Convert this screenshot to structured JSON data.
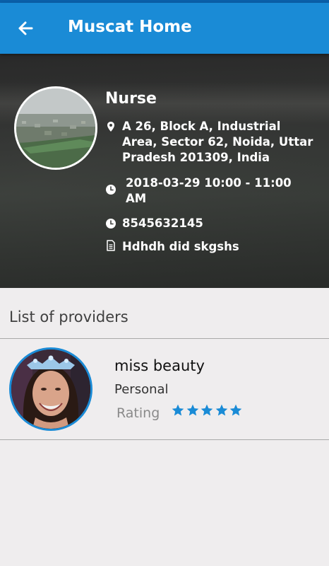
{
  "app_bar": {
    "title": "Muscat Home"
  },
  "booking": {
    "service": "Nurse",
    "address": "A 26, Block A, Industrial Area, Sector 62, Noida, Uttar Pradesh 201309, India",
    "datetime": "2018-03-29 10:00 - 11:00 AM",
    "phone": "8545632145",
    "note": "Hdhdh did skgshs"
  },
  "providers_section": {
    "title": "List of providers",
    "items": [
      {
        "name": "miss beauty",
        "type": "Personal",
        "rating_label": "Rating",
        "rating": 5,
        "rating_max": 5
      }
    ]
  },
  "icons": {
    "back": "arrow-left-icon",
    "address": "location-pin-icon",
    "datetime": "clock-icon",
    "phone": "clock-icon",
    "note": "document-icon",
    "star": "star-icon"
  },
  "colors": {
    "primary": "#1a8bd6",
    "status_bar": "#0a5fa8",
    "background": "#efedee",
    "star": "#1a8bd6"
  }
}
